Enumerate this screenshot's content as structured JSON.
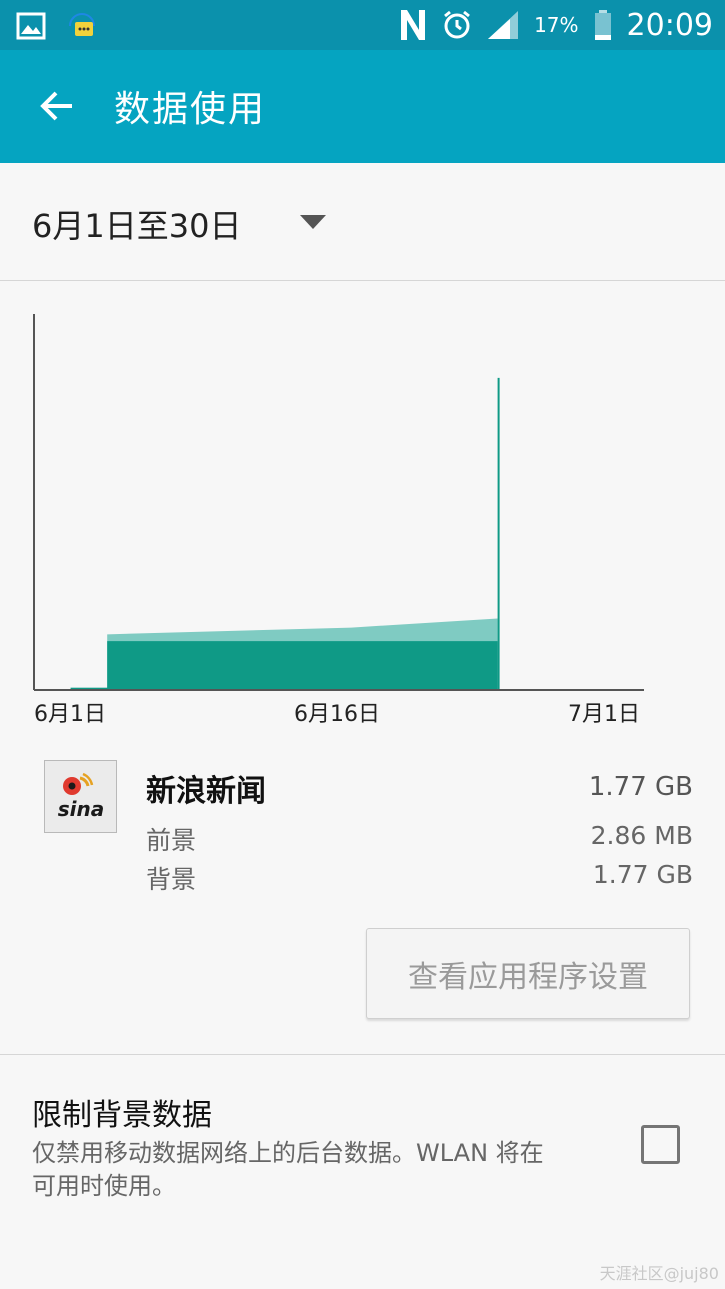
{
  "status_bar": {
    "time": "20:09",
    "battery_percent": "17%",
    "icons": [
      "gallery-icon",
      "message-icon",
      "nfc-icon",
      "alarm-icon",
      "signal-icon",
      "battery-icon"
    ]
  },
  "app_bar": {
    "back_icon": "arrow-left-icon",
    "title": "数据使用"
  },
  "period": {
    "label": "6月1日至30日",
    "dropdown_icon": "caret-down-icon"
  },
  "chart_data": {
    "type": "area",
    "x_tick_labels": [
      "6月1日",
      "6月16日",
      "7月1日"
    ],
    "series": [
      {
        "values": [
          0.03,
          0.16,
          0.19
        ]
      },
      {
        "values": [
          0.03,
          0.13,
          0.13
        ]
      }
    ],
    "colors": {
      "background": "#0f9a86",
      "foreground": "#7fcbc2",
      "axis": "#555555"
    }
  },
  "app": {
    "icon": "sina-logo-icon",
    "icon_text": "sina",
    "name": "新浪新闻",
    "total": "1.77 GB",
    "foreground_label": "前景",
    "foreground_value": "2.86 MB",
    "background_label": "背景",
    "background_value": "1.77 GB",
    "settings_button": "查看应用程序设置"
  },
  "restrict": {
    "title": "限制背景数据",
    "description": "仅禁用移动数据网络上的后台数据。WLAN 将在可用时使用。",
    "checked": false
  },
  "watermark": "天涯社区@juj80",
  "colors": {
    "status_bar": "#0b91ac",
    "app_bar": "#05a4c1"
  }
}
